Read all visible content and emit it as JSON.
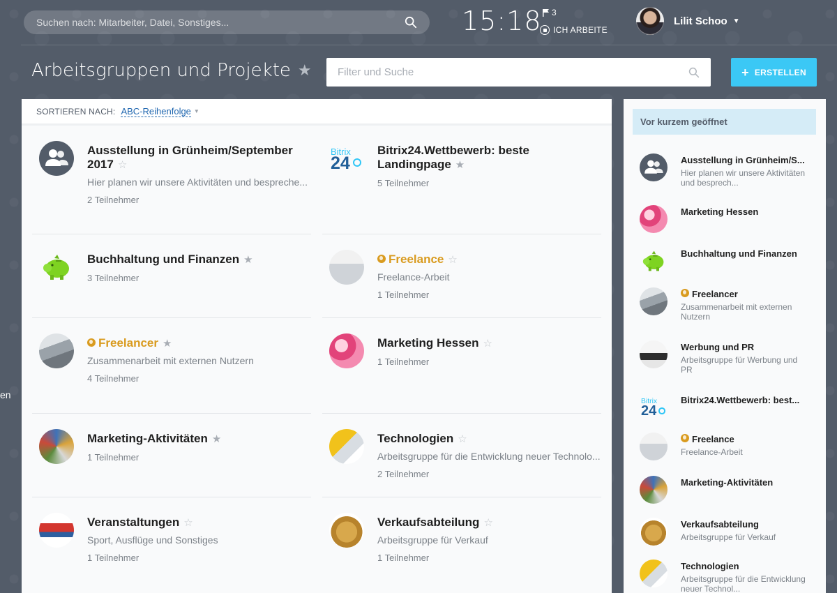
{
  "topbar": {
    "search_placeholder": "Suchen nach: Mitarbeiter, Datei, Sonstiges...",
    "time": "15:18",
    "flag_count": "3",
    "work_status": "ICH ARBEITE",
    "user_name": "Lilit Schoo"
  },
  "header": {
    "title": "Arbeitsgruppen und Projekte",
    "filter_placeholder": "Filter und Suche",
    "create_label": "ERSTELLEN"
  },
  "side_hint": "en",
  "sort": {
    "label": "SORTIEREN NACH:",
    "value": "ABC-Reihenfolge"
  },
  "groups": [
    {
      "title": "Ausstellung in Grünheim/September 2017",
      "desc": "Hier planen wir unsere Aktivitäten und bespreche...",
      "members": "2 Teilnehmer",
      "favorite": false,
      "extranet": false,
      "avatar": "group-icon"
    },
    {
      "title": "Bitrix24.Wettbewerb: beste Landingpage",
      "desc": "",
      "members": "5 Teilnehmer",
      "favorite": true,
      "extranet": false,
      "avatar": "bitrix-logo"
    },
    {
      "title": "Buchhaltung und Finanzen",
      "desc": "",
      "members": "3 Teilnehmer",
      "favorite": true,
      "extranet": false,
      "avatar": "piggy-bank"
    },
    {
      "title": "Freelance",
      "desc": "Freelance-Arbeit",
      "members": "1 Teilnehmer",
      "favorite": false,
      "extranet": true,
      "avatar": "people-photo"
    },
    {
      "title": "Freelancer",
      "desc": "Zusammenarbeit mit externen Nutzern",
      "members": "4 Teilnehmer",
      "favorite": true,
      "extranet": true,
      "avatar": "grey-photo"
    },
    {
      "title": "Marketing Hessen",
      "desc": "",
      "members": "1 Teilnehmer",
      "favorite": false,
      "extranet": false,
      "avatar": "pink-photo"
    },
    {
      "title": "Marketing-Aktivitäten",
      "desc": "",
      "members": "1 Teilnehmer",
      "favorite": true,
      "extranet": false,
      "avatar": "mixed-photo"
    },
    {
      "title": "Technologien",
      "desc": "Arbeitsgruppe für die Entwicklung neuer Technolo...",
      "members": "2 Teilnehmer",
      "favorite": false,
      "extranet": false,
      "avatar": "tech-photo"
    },
    {
      "title": "Veranstaltungen",
      "desc": "Sport, Ausflüge und Sonstiges",
      "members": "1 Teilnehmer",
      "favorite": false,
      "extranet": false,
      "avatar": "sport-photo"
    },
    {
      "title": "Verkaufsabteilung",
      "desc": "Arbeitsgruppe für Verkauf",
      "members": "1 Teilnehmer",
      "favorite": false,
      "extranet": false,
      "avatar": "coins-photo"
    }
  ],
  "recent": {
    "title": "Vor kurzem geöffnet",
    "items": [
      {
        "title": "Ausstellung in Grünheim/S...",
        "desc": "Hier planen wir unsere Aktivitäten und besprech...",
        "extranet": false,
        "avatar": "group-icon"
      },
      {
        "title": "Marketing Hessen",
        "desc": "",
        "extranet": false,
        "avatar": "pink-photo"
      },
      {
        "title": "Buchhaltung und Finanzen",
        "desc": "",
        "extranet": false,
        "avatar": "piggy-bank"
      },
      {
        "title": "Freelancer",
        "desc": "Zusammenarbeit mit externen Nutzern",
        "extranet": true,
        "avatar": "grey-photo"
      },
      {
        "title": "Werbung und PR",
        "desc": "Arbeitsgruppe für Werbung und PR",
        "extranet": false,
        "avatar": "werbung-photo"
      },
      {
        "title": "Bitrix24.Wettbewerb: best...",
        "desc": "",
        "extranet": false,
        "avatar": "bitrix-logo"
      },
      {
        "title": "Freelance",
        "desc": "Freelance-Arbeit",
        "extranet": true,
        "avatar": "people-photo"
      },
      {
        "title": "Marketing-Aktivitäten",
        "desc": "",
        "extranet": false,
        "avatar": "mixed-photo"
      },
      {
        "title": "Verkaufsabteilung",
        "desc": "Arbeitsgruppe für Verkauf",
        "extranet": false,
        "avatar": "coins-photo"
      },
      {
        "title": "Technologien",
        "desc": "Arbeitsgruppe für die Entwicklung neuer Technol...",
        "extranet": false,
        "avatar": "tech-photo"
      }
    ]
  },
  "colors": {
    "background": "#535c69",
    "accent": "#3bc8f5",
    "link": "#2067b0",
    "extranet": "#d99b1f",
    "recent_header": "#d5ecf7"
  },
  "logo_text": {
    "bitrix_word": "Bitrix",
    "bitrix_num": "24"
  }
}
